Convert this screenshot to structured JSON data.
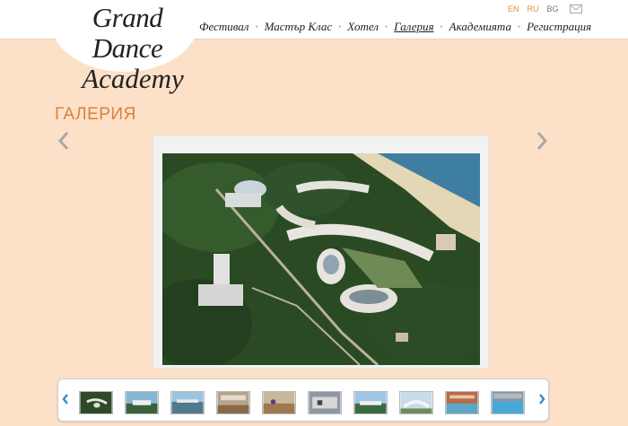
{
  "logo": {
    "line1": "Grand Dance",
    "line2": "Academy"
  },
  "nav": {
    "items": [
      {
        "label": "Фестивал"
      },
      {
        "label": "Мастър Клас"
      },
      {
        "label": "Хотел"
      },
      {
        "label": "Галерия",
        "active": true
      },
      {
        "label": "Академията"
      },
      {
        "label": "Регистрация"
      }
    ]
  },
  "languages": {
    "en": "EN",
    "ru": "RU",
    "bg": "BG"
  },
  "icons": {
    "mail": "mail-icon",
    "prev": "chevron-left-icon",
    "next": "chevron-right-icon"
  },
  "page": {
    "title": "ГАЛЕРИЯ"
  },
  "gallery": {
    "main_photo": "aerial-hotel-photo",
    "thumbnail_count": 10
  },
  "colors": {
    "background": "#fde0c8",
    "accent": "#d9823a",
    "lang_active": "#e0932a",
    "arrow": "#a8a8a8",
    "strip_arrow": "#3c8dc5"
  }
}
